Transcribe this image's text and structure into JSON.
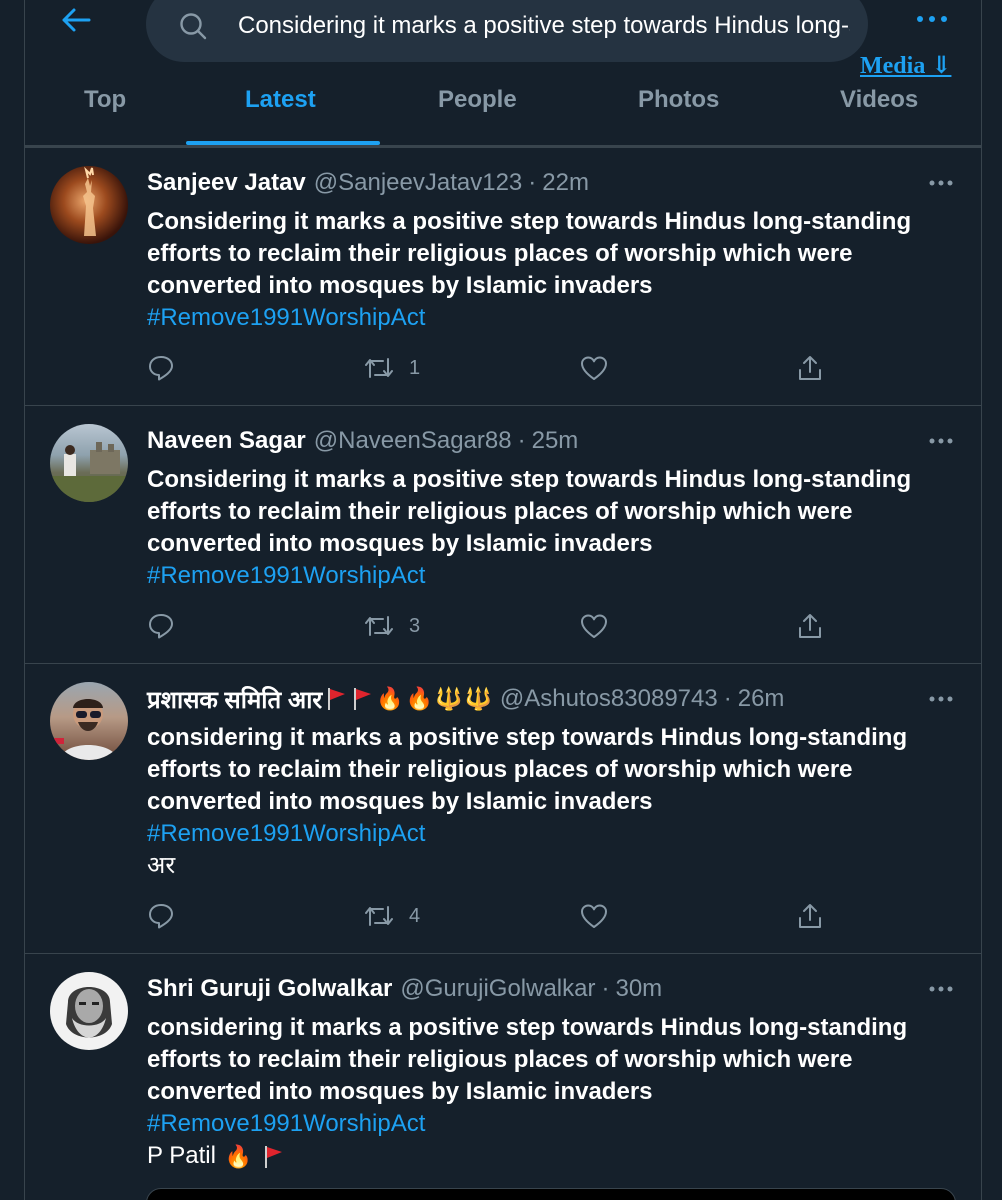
{
  "header": {
    "search_value": "Considering it marks a positive step towards Hindus long-standing efforts to reclaim their religious places of worship which were converted into mosques by Islamic invaders",
    "media_link": "Media ⇓",
    "accent_color": "#1da1f2"
  },
  "tabs": [
    {
      "label": "Top",
      "active": false
    },
    {
      "label": "Latest",
      "active": true
    },
    {
      "label": "People",
      "active": false
    },
    {
      "label": "Photos",
      "active": false
    },
    {
      "label": "Videos",
      "active": false
    }
  ],
  "tweets": [
    {
      "name": "Sanjeev Jatav",
      "handle": "@SanjeevJatav123",
      "time": "22m",
      "text": "Considering it marks a positive step towards Hindus long-standing efforts to reclaim their religious places of worship which were converted into mosques by Islamic invaders",
      "hashtag": "#Remove1991WorshipAct",
      "extra": "",
      "retweets": "1"
    },
    {
      "name": "Naveen Sagar",
      "handle": "@NaveenSagar88",
      "time": "25m",
      "text": "Considering it marks a positive step towards Hindus long-standing efforts to reclaim their religious places of worship which were converted into mosques by Islamic invaders",
      "hashtag": "#Remove1991WorshipAct",
      "extra": "",
      "retweets": "3"
    },
    {
      "name": "प्रशासक समिति आर",
      "name_emoji": [
        "🔥",
        "🔥",
        "🔱",
        "🔱"
      ],
      "handle": "@Ashutos83089743",
      "time": "26m",
      "text": "considering it marks a positive step towards Hindus long-standing efforts to reclaim their religious places of worship which were converted into mosques by Islamic invaders",
      "hashtag": "#Remove1991WorshipAct",
      "extra": "अर",
      "retweets": "4"
    },
    {
      "name": "Shri Guruji Golwalkar",
      "handle": "@GurujiGolwalkar",
      "time": "30m",
      "text": "considering it marks a positive step towards Hindus long-standing efforts to reclaim their religious places of worship which were converted into mosques by Islamic invaders",
      "hashtag": "#Remove1991WorshipAct",
      "extra": "P Patil",
      "extra_emoji": "🔥"
    }
  ]
}
